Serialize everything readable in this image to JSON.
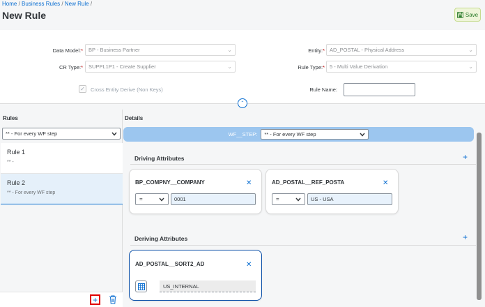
{
  "breadcrumb": {
    "items": [
      "Home",
      "Business Rules",
      "New Rule"
    ],
    "sep": "/"
  },
  "page": {
    "title": "New Rule"
  },
  "toolbar": {
    "save_label": "Save"
  },
  "form": {
    "data_model": {
      "label": "Data Model:",
      "value": "BP - Business Partner"
    },
    "cr_type": {
      "label": "CR Type:",
      "value": "SUPPL1P1 - Create Supplier"
    },
    "cross_entity": {
      "label": "Cross Entity Derive (Non Keys)",
      "checked": true
    },
    "entity": {
      "label": "Entity:",
      "value": "AD_POSTAL - Physical Address"
    },
    "rule_type": {
      "label": "Rule Type:",
      "value": "5 - Multi Value Derivation"
    },
    "rule_name": {
      "label": "Rule Name:",
      "value": ""
    },
    "required_mark": "*"
  },
  "rules": {
    "title": "Rules",
    "filter_value": "** - For every WF step",
    "items": [
      {
        "name": "Rule 1",
        "sub": "** -",
        "selected": false
      },
      {
        "name": "Rule 2",
        "sub": "** - For every WF step",
        "selected": true
      }
    ]
  },
  "details": {
    "title": "Details",
    "wf_step": {
      "label": "WF__STEP:",
      "value": "** - For every WF step"
    },
    "driving": {
      "title": "Driving Attributes",
      "cards": [
        {
          "title": "BP_COMPNY__COMPANY",
          "operator": "=",
          "value": "0001"
        },
        {
          "title": "AD_POSTAL__REF_POSTA",
          "operator": "=",
          "value": "US - USA"
        }
      ]
    },
    "deriving": {
      "title": "Deriving Attributes",
      "cards": [
        {
          "title": "AD_POSTAL__SORT2_AD",
          "value": "US_INTERNAL"
        }
      ]
    }
  },
  "icons": {
    "save": "save-icon",
    "chevron": "chevron-down-icon",
    "collapse": "chevron-up-icon",
    "add": "plus-icon",
    "delete": "trash-icon",
    "close": "close-icon",
    "table": "table-icon",
    "check": "checkmark-icon"
  },
  "colors": {
    "accent": "#0a6ed1",
    "highlight": "#e00000",
    "wf_bar": "#9cc6ef",
    "save_bg": "#eef5d9"
  }
}
